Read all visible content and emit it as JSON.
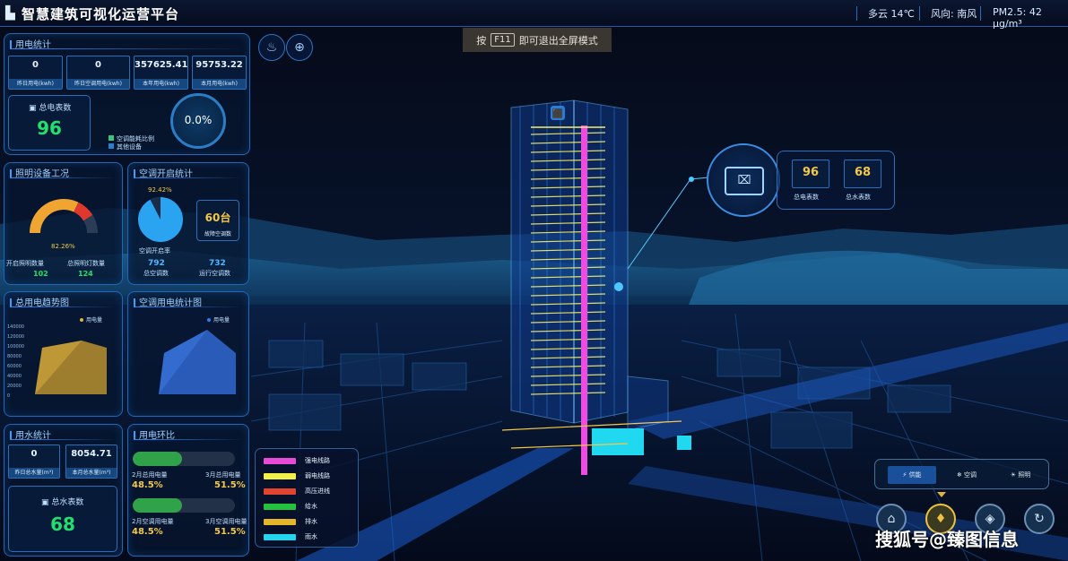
{
  "header": {
    "title": "智慧建筑可视化运营平台",
    "weather": "多云  14℃",
    "wind": "风向: 南风",
    "pm25": "PM2.5:  42 μg/m³"
  },
  "tip": {
    "prefix": "按",
    "key": "F11",
    "suffix": "即可退出全屏模式"
  },
  "power_stats": {
    "title": "用电统计",
    "boxes": [
      {
        "value": "0",
        "label": "昨日用电(kwh)"
      },
      {
        "value": "0",
        "label": "昨日空调用电(kwh)"
      },
      {
        "value": "357625.41",
        "label": "本年用电(kwh)"
      },
      {
        "value": "95753.22",
        "label": "本月用电(kwh)"
      }
    ],
    "meter_label": "总电表数",
    "meter_value": "96",
    "gauge_value": "0.0%",
    "legend": [
      "空调能耗比例",
      "其他设备"
    ]
  },
  "lighting": {
    "title": "照明设备工况",
    "percent": "82.26%",
    "percent_value": 82.26,
    "on_label": "开启照明数量",
    "on_value": "102",
    "total_label": "总照明灯数量",
    "total_value": "124"
  },
  "ac_stats": {
    "title": "空调开启统计",
    "percent": "92.42%",
    "percent_value": 92.42,
    "rate_label": "空调开启率",
    "fault_value": "60台",
    "fault_label": "故障空调数",
    "total_value": "792",
    "total_label": "总空调数",
    "running_value": "732",
    "running_label": "运行空调数"
  },
  "power_trend": {
    "title": "总用电趋势图",
    "legend": "用电量",
    "ticks": [
      "140000",
      "120000",
      "100000",
      "80000",
      "60000",
      "40000",
      "20000",
      "0"
    ]
  },
  "ac_trend": {
    "title": "空调用电统计图",
    "legend": "用电量"
  },
  "water_stats": {
    "title": "用水统计",
    "boxes": [
      {
        "value": "0",
        "label": "昨日总水量(m³)"
      },
      {
        "value": "8054.71",
        "label": "本月总水量(m³)"
      }
    ],
    "meter_label": "总水表数",
    "meter_value": "68"
  },
  "power_ratio": {
    "title": "用电环比",
    "rows": [
      {
        "left_label": "2月总用电量",
        "right_label": "3月总用电量",
        "left_pct": "48.5%",
        "right_pct": "51.5%",
        "left_value": 48.5
      },
      {
        "left_label": "2月空调用电量",
        "right_label": "3月空调用电量",
        "left_pct": "48.5%",
        "right_pct": "51.5%",
        "left_value": 48.5
      }
    ]
  },
  "pipe_legend": [
    {
      "label": "强电线路",
      "color": "#e64bd8"
    },
    {
      "label": "弱电线路",
      "color": "#f2ee4a"
    },
    {
      "label": "高压进线",
      "color": "#e2452f"
    },
    {
      "label": "给水",
      "color": "#25c23f"
    },
    {
      "label": "排水",
      "color": "#e3b52b"
    },
    {
      "label": "雨水",
      "color": "#22d6f0"
    }
  ],
  "callout": {
    "electric_value": "96",
    "electric_label": "总电表数",
    "water_value": "68",
    "water_label": "总水表数"
  },
  "controls": {
    "tabs": [
      "供能",
      "空调",
      "照明"
    ],
    "icons": [
      "building-icon",
      "water-drop-icon",
      "security-icon",
      "refresh-icon"
    ]
  },
  "watermark": "搜狐号@臻图信息",
  "colors": {
    "accent": "#1d69b8",
    "green": "#22e06e",
    "yellow": "#f4c84a",
    "ratio_bar": "#2fa24a"
  }
}
